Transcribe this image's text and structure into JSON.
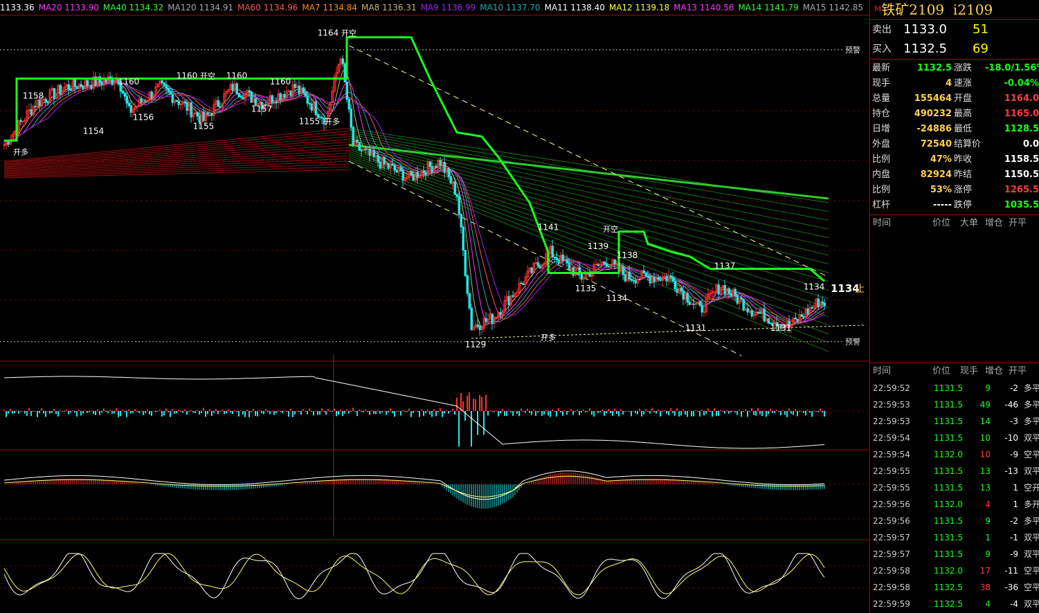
{
  "ma_legend": [
    {
      "text": "1133.36",
      "color": "#ffffff"
    },
    {
      "text": "MA20 1133.90",
      "color": "#ff33ff"
    },
    {
      "text": "MA40 1134.32",
      "color": "#33ff33"
    },
    {
      "text": "MA120 1134.91",
      "color": "#aaaaaa"
    },
    {
      "text": "MA60 1134.96",
      "color": "#ff5555"
    },
    {
      "text": "MA7 1134.84",
      "color": "#ff8c1a"
    },
    {
      "text": "MA8 1136.31",
      "color": "#c8b46e"
    },
    {
      "text": "MA9 1136.99",
      "color": "#a020f0"
    },
    {
      "text": "MA10 1137.70",
      "color": "#2aa7b9"
    },
    {
      "text": "MA11 1138.40",
      "color": "#ffffff"
    },
    {
      "text": "MA12 1139.18",
      "color": "#ffff33"
    },
    {
      "text": "MA13 1140.56",
      "color": "#ff33ff"
    },
    {
      "text": "MA14 1141.79",
      "color": "#33ff33"
    },
    {
      "text": "MA15 1142.85",
      "color": "#aaaaaa"
    }
  ],
  "header": {
    "marker": "M",
    "name": "铁矿2109",
    "code": "i2109"
  },
  "quotes": [
    {
      "label": "卖出",
      "price": "1133.0",
      "vol": "51"
    },
    {
      "label": "买入",
      "price": "1132.5",
      "vol": "69"
    }
  ],
  "stats": [
    {
      "l1": "最新",
      "v1": "1132.5",
      "c1": "#1aff1a",
      "l2": "涨跌",
      "v2": "-18.0/1.56%",
      "c2": "#1aff1a"
    },
    {
      "l1": "现手",
      "v1": "4",
      "c1": "#ffd24a",
      "l2": "速涨",
      "v2": "-0.04%",
      "c2": "#1aff1a"
    },
    {
      "l1": "总量",
      "v1": "155464",
      "c1": "#ffd24a",
      "l2": "开盘",
      "v2": "1164.0",
      "c2": "#ff3b3b"
    },
    {
      "l1": "持仓",
      "v1": "490232",
      "c1": "#ffd24a",
      "l2": "最高",
      "v2": "1165.0",
      "c2": "#ff3b3b"
    },
    {
      "l1": "日增",
      "v1": "-24886",
      "c1": "#ffd24a",
      "l2": "最低",
      "v2": "1128.5",
      "c2": "#1aff1a"
    },
    {
      "l1": "外盘",
      "v1": "72540",
      "c1": "#ffd24a",
      "l2": "结算价",
      "v2": "0.0",
      "c2": "#ffffff"
    },
    {
      "l1": "比例",
      "v1": "47%",
      "c1": "#ffd24a",
      "l2": "昨收",
      "v2": "1158.5",
      "c2": "#ffffff"
    },
    {
      "l1": "内盘",
      "v1": "82924",
      "c1": "#ffd24a",
      "l2": "昨结",
      "v2": "1150.5",
      "c2": "#ffffff"
    },
    {
      "l1": "比例",
      "v1": "53%",
      "c1": "#ffd24a",
      "l2": "涨停",
      "v2": "1265.5",
      "c2": "#ff3b3b"
    },
    {
      "l1": "杠杆",
      "v1": "-----",
      "c1": "#ffffff",
      "l2": "跌停",
      "v2": "1035.5",
      "c2": "#1aff1a"
    }
  ],
  "detail_head": [
    "时间",
    "价位",
    "大单",
    "增仓",
    "开平"
  ],
  "tick_head": [
    "时间",
    "价位",
    "现手",
    "增仓",
    "开平"
  ],
  "ticks": [
    {
      "t": "22:59:52",
      "p": "1131.5",
      "q": "9",
      "qc": "#1aff1a",
      "d": "-2",
      "k": "多平"
    },
    {
      "t": "22:59:53",
      "p": "1131.5",
      "q": "49",
      "qc": "#1aff1a",
      "d": "-46",
      "k": "多平"
    },
    {
      "t": "22:59:53",
      "p": "1131.5",
      "q": "14",
      "qc": "#1aff1a",
      "d": "-3",
      "k": "多平"
    },
    {
      "t": "22:59:54",
      "p": "1131.5",
      "q": "10",
      "qc": "#1aff1a",
      "d": "-10",
      "k": "双平"
    },
    {
      "t": "22:59:54",
      "p": "1132.0",
      "q": "10",
      "qc": "#ff3b3b",
      "d": "-9",
      "k": "空平"
    },
    {
      "t": "22:59:55",
      "p": "1131.5",
      "q": "13",
      "qc": "#1aff1a",
      "d": "-13",
      "k": "双平"
    },
    {
      "t": "22:59:55",
      "p": "1131.5",
      "q": "13",
      "qc": "#1aff1a",
      "d": "1",
      "k": "空开"
    },
    {
      "t": "22:59:56",
      "p": "1132.0",
      "q": "4",
      "qc": "#ff3b3b",
      "d": "1",
      "k": "多开"
    },
    {
      "t": "22:59:56",
      "p": "1131.5",
      "q": "9",
      "qc": "#1aff1a",
      "d": "-2",
      "k": "多平"
    },
    {
      "t": "22:59:57",
      "p": "1131.5",
      "q": "1",
      "qc": "#1aff1a",
      "d": "-1",
      "k": "双平"
    },
    {
      "t": "22:59:57",
      "p": "1131.5",
      "q": "9",
      "qc": "#1aff1a",
      "d": "-9",
      "k": "双平"
    },
    {
      "t": "22:59:58",
      "p": "1132.0",
      "q": "17",
      "qc": "#ff3b3b",
      "d": "-11",
      "k": "空平"
    },
    {
      "t": "22:59:58",
      "p": "1132.5",
      "q": "38",
      "qc": "#ff3b3b",
      "d": "-36",
      "k": "空平"
    },
    {
      "t": "22:59:59",
      "p": "1132.5",
      "q": "4",
      "qc": "#1aff1a",
      "d": "-4",
      "k": "双平"
    }
  ],
  "chart_data": {
    "type": "candlestick",
    "ylim": [
      1126,
      1167
    ],
    "alert_label": "预警",
    "alert_levels": [
      1163.5,
      1128.2
    ],
    "current_price_label": "1134",
    "stop_mark": "止",
    "price_labels": [
      {
        "text": "1158",
        "x": 14,
        "y": 1157.6
      },
      {
        "text": "1160",
        "x": 60,
        "y": 1159.3
      },
      {
        "text": "1160",
        "x": 88,
        "y": 1160.0
      },
      {
        "text": "1160",
        "x": 112,
        "y": 1160.0
      },
      {
        "text": "1160",
        "x": 133,
        "y": 1159.3
      },
      {
        "text": "1154",
        "x": 43,
        "y": 1153.3
      },
      {
        "text": "1156",
        "x": 67,
        "y": 1155.0
      },
      {
        "text": "1155",
        "x": 96,
        "y": 1153.9
      },
      {
        "text": "1157",
        "x": 124,
        "y": 1156.0
      },
      {
        "text": "1155",
        "x": 147,
        "y": 1154.5
      },
      {
        "text": "1164",
        "x": 156,
        "y": 1165.2
      },
      {
        "text": "1129",
        "x": 227,
        "y": 1127.5
      },
      {
        "text": "1141",
        "x": 262,
        "y": 1141.7
      },
      {
        "text": "1139",
        "x": 286,
        "y": 1139.4
      },
      {
        "text": "1138",
        "x": 300,
        "y": 1138.3
      },
      {
        "text": "1135",
        "x": 280,
        "y": 1134.3
      },
      {
        "text": "1134",
        "x": 295,
        "y": 1133.1
      },
      {
        "text": "1137",
        "x": 347,
        "y": 1137.0
      },
      {
        "text": "1131",
        "x": 333,
        "y": 1129.5
      },
      {
        "text": "1131",
        "x": 374,
        "y": 1129.5
      },
      {
        "text": "1134",
        "x": 390,
        "y": 1134.5
      }
    ],
    "signal_labels": [
      {
        "text": "开多",
        "x": 8,
        "y": 1150.8
      },
      {
        "text": "开空",
        "x": 98,
        "y": 1160.0
      },
      {
        "text": "开空",
        "x": 166,
        "y": 1165.2
      },
      {
        "text": "开多",
        "x": 158,
        "y": 1154.5
      },
      {
        "text": "开多",
        "x": 262,
        "y": 1128.4
      },
      {
        "text": "开空",
        "x": 292,
        "y": 1141.5
      }
    ],
    "stop_line": [
      [
        0,
        1152.5
      ],
      [
        6,
        1152.5
      ],
      [
        6,
        1160
      ],
      [
        165,
        1160
      ],
      [
        165,
        1165
      ],
      [
        196,
        1165
      ],
      [
        205,
        1160
      ],
      [
        218,
        1153.5
      ],
      [
        230,
        1153
      ],
      [
        238,
        1150.5
      ],
      [
        253,
        1145
      ],
      [
        262,
        1139
      ],
      [
        262,
        1136.5
      ],
      [
        296,
        1136.5
      ],
      [
        296,
        1141.5
      ],
      [
        308,
        1141.5
      ],
      [
        310,
        1140
      ],
      [
        322,
        1139
      ],
      [
        330,
        1138.5
      ],
      [
        340,
        1137
      ],
      [
        388,
        1137
      ],
      [
        395,
        1135.5
      ]
    ],
    "indicators": [
      "volume",
      "macd",
      "kdj"
    ]
  }
}
